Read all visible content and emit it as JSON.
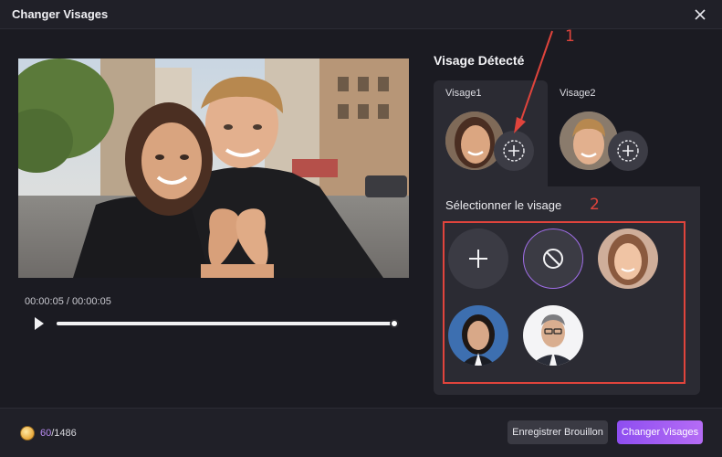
{
  "window": {
    "title": "Changer Visages"
  },
  "preview": {
    "time": "00:00:05 / 00:00:05",
    "progress": 1.0
  },
  "detected": {
    "title": "Visage Détecté",
    "faces": [
      {
        "label": "Visage1",
        "selected": true
      },
      {
        "label": "Visage2",
        "selected": false
      }
    ]
  },
  "select": {
    "title": "Sélectionner le visage",
    "options": [
      "add-face",
      "no-face",
      "face-woman-1",
      "face-woman-2",
      "face-man-1"
    ]
  },
  "annotations": {
    "one": "1",
    "two": "2"
  },
  "footer": {
    "credits_used": "60",
    "credits_total": "/1486",
    "draft_label": "Enregistrer Brouillon",
    "apply_label": "Changer Visages"
  },
  "colors": {
    "accent": "#a06ee8",
    "annotation": "#e0443c",
    "background": "#1b1b22"
  }
}
